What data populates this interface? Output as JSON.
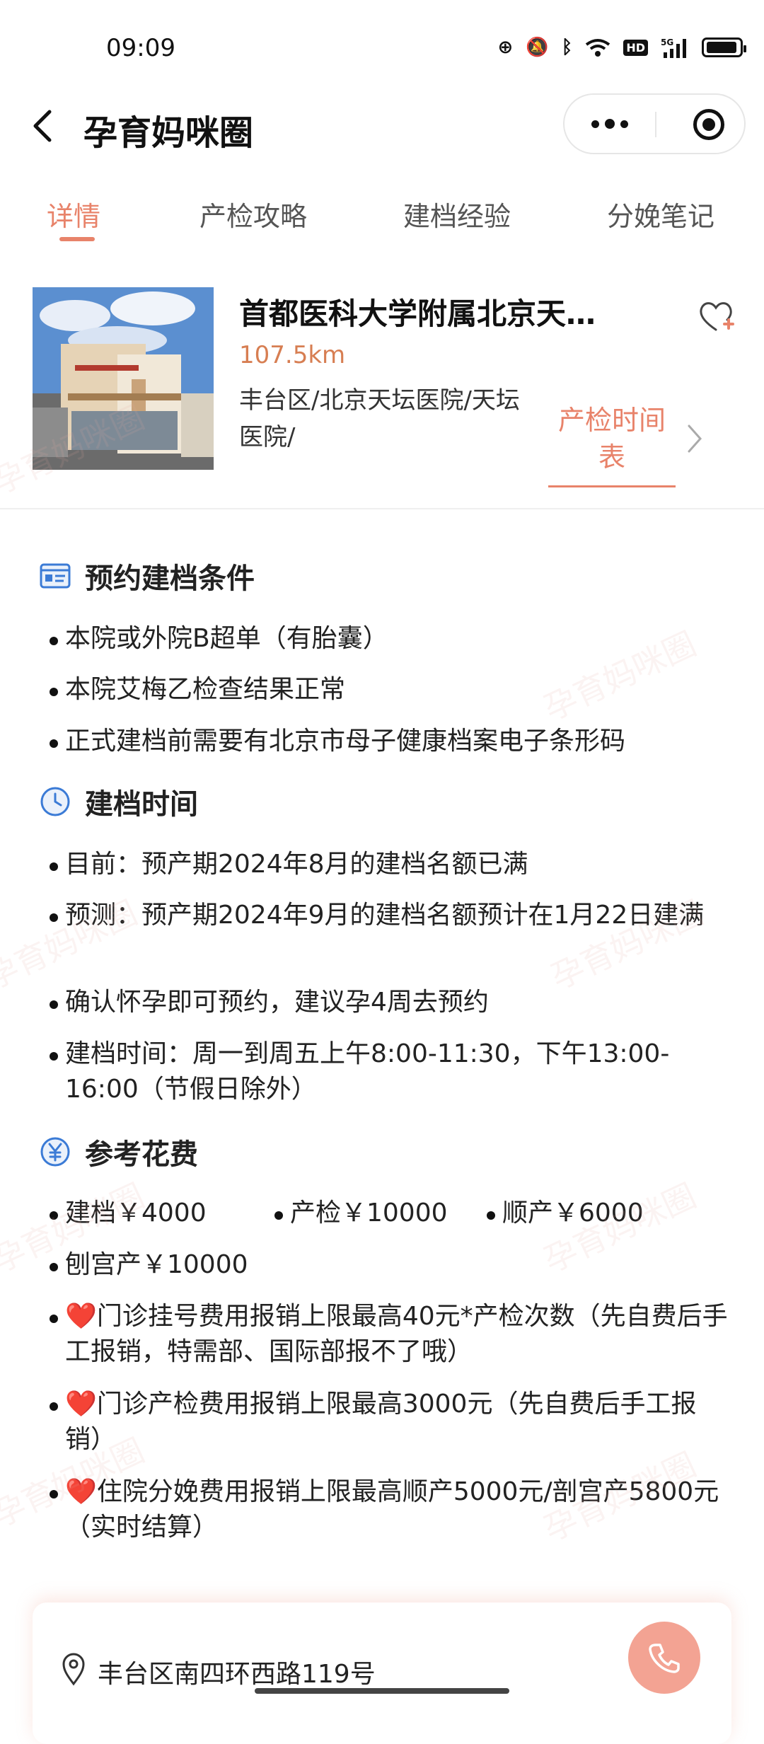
{
  "status": {
    "time": "09:09",
    "icons": [
      "vpn-icon",
      "mute-icon",
      "bluetooth-icon",
      "wifi-icon",
      "hd-icon",
      "5g-signal-icon",
      "battery-icon"
    ]
  },
  "nav": {
    "back_icon": "chevron-left-icon",
    "title": "孕育妈咪圈"
  },
  "tabs": [
    "详情",
    "产检攻略",
    "建档经验",
    "分娩笔记"
  ],
  "hospital": {
    "name": "首都医科大学附属北京天…",
    "distance": "107.5km",
    "area": "丰台区/北京天坛医院/天坛医院/",
    "schedule_label_1": "产检时间",
    "schedule_label_2": "表",
    "accent_color": "#e8836a"
  },
  "conditions": {
    "title": "预约建档条件",
    "items": [
      "本院或外院B超单（有胎囊）",
      "本院艾梅乙检查结果正常",
      "正式建档前需要有北京市母子健康档案电子条形码"
    ]
  },
  "timing": {
    "title": "建档时间",
    "items": [
      "目前：预产期2024年8月的建档名额已满",
      "预测：预产期2024年9月的建档名额预计在1月22日建满",
      "确认怀孕即可预约，建议孕4周去预约",
      "建档时间：周一到周五上午8:00-11:30，下午13:00-16:00（节假日除外）"
    ]
  },
  "costs": {
    "title": "参考花费",
    "inline": [
      "建档￥4000",
      "产检￥10000",
      "顺产￥6000"
    ],
    "csection": "刨宫产￥10000",
    "heart": "❤️",
    "notes": [
      "门诊挂号费用报销上限最高40元*产检次数（先自费后手工报销，特需部、国际部报不了哦）",
      "门诊产检费用报销上限最高3000元（先自费后手工报销）",
      "住院分娩费用报销上限最高顺产5000元/剖宫产5800元（实时结算）"
    ]
  },
  "address": {
    "text": "丰台区南四环西路119号",
    "phone_icon": "phone-icon"
  },
  "watermark_text": "孕育妈咪圈"
}
